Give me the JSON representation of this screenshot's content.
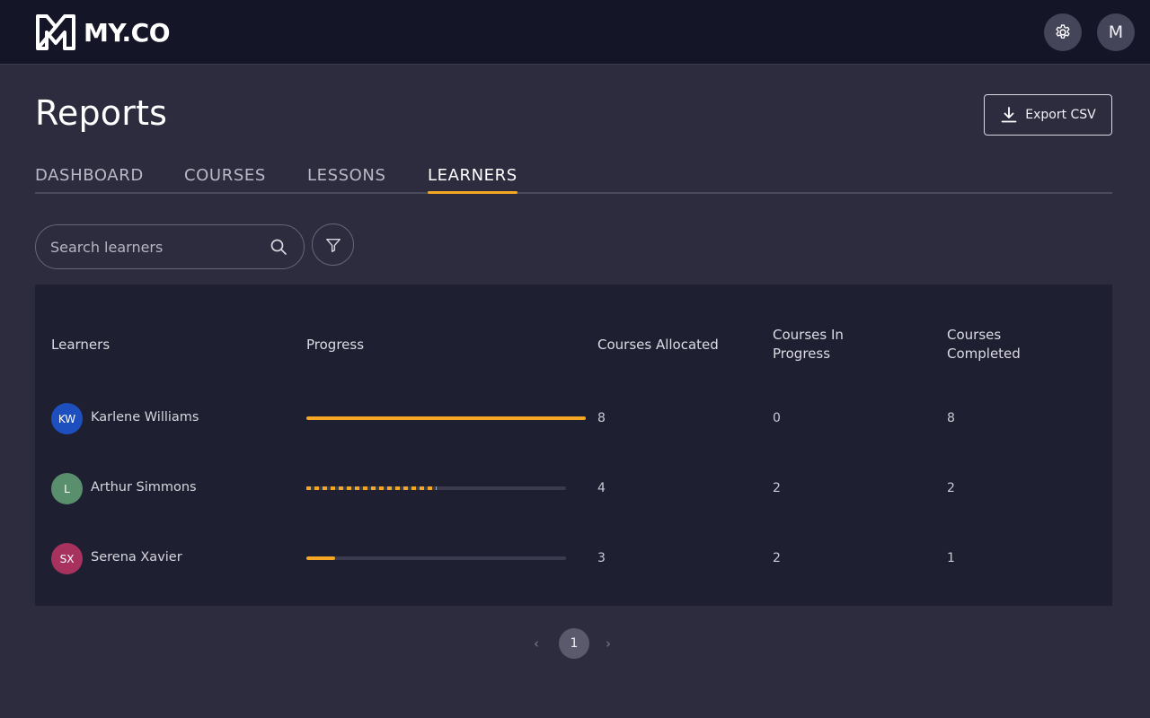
{
  "brand": {
    "name": "MY.CO"
  },
  "header": {
    "settings_icon": "gear-icon",
    "avatar_initial": "M"
  },
  "page": {
    "title": "Reports",
    "export_label": "Export CSV"
  },
  "tabs": [
    {
      "label": "DASHBOARD",
      "active": false
    },
    {
      "label": "COURSES",
      "active": false
    },
    {
      "label": "LESSONS",
      "active": false
    },
    {
      "label": "LEARNERS",
      "active": true
    }
  ],
  "search": {
    "placeholder": "Search learners",
    "value": ""
  },
  "table": {
    "columns": [
      "Learners",
      "Progress",
      "Courses Allocated",
      "Courses In Progress",
      "Courses Completed"
    ],
    "rows": [
      {
        "initials": "KW",
        "avatar_color": "#1e4fbf",
        "name": "Karlene Williams",
        "progress": 1.0,
        "progress_style": "solid",
        "allocated": "8",
        "in_progress": "0",
        "completed": "8"
      },
      {
        "initials": "L",
        "avatar_color": "#5a8f6e",
        "name": "Arthur Simmons",
        "progress": 0.5,
        "progress_style": "dashed",
        "allocated": "4",
        "in_progress": "2",
        "completed": "2"
      },
      {
        "initials": "SX",
        "avatar_color": "#a8325e",
        "name": "Serena Xavier",
        "progress": 0.11,
        "progress_style": "solid",
        "allocated": "3",
        "in_progress": "2",
        "completed": "1"
      }
    ]
  },
  "pagination": {
    "current": "1",
    "prev_icon": "chevron-left-icon",
    "next_icon": "chevron-right-icon"
  },
  "colors": {
    "accent": "#f5a623",
    "background": "#2c2c3e",
    "topbar": "#151528",
    "panel": "#1f1f32"
  }
}
